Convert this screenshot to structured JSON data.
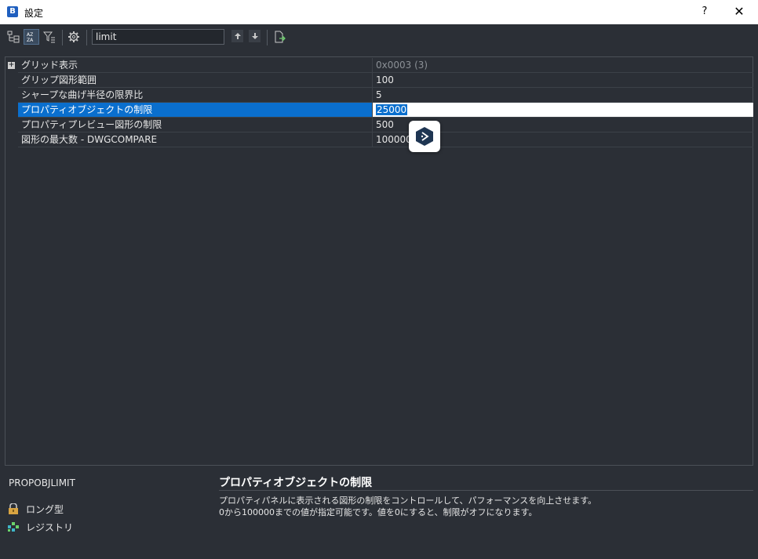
{
  "window": {
    "title": "設定",
    "help_label": "?",
    "close_label": "✕"
  },
  "toolbar": {
    "search_value": "limit",
    "buttons": [
      "categorized-view",
      "alphabetic-view",
      "filter",
      "settings",
      "previous",
      "next",
      "export"
    ]
  },
  "grid": {
    "rows": [
      {
        "name": "グリッド表示",
        "value": "0x0003 (3)",
        "expandable": true,
        "readonly": true
      },
      {
        "name": "グリップ図形範囲",
        "value": "100"
      },
      {
        "name": "シャープな曲げ半径の限界比",
        "value": "5"
      },
      {
        "name": "プロパティオブジェクトの制限",
        "value": "25000",
        "selected": true
      },
      {
        "name": "プロパティプレビュー図形の制限",
        "value": "500"
      },
      {
        "name": "図形の最大数 - DWGCOMPARE",
        "value": "100000"
      }
    ]
  },
  "info": {
    "variable": "PROPOBJLIMIT",
    "type_label": "ロング型",
    "storage_label": "レジストリ",
    "title": "プロパティオブジェクトの制限",
    "description_line1": "プロパティパネルに表示される図形の制限をコントロールして、パフォーマンスを向上させます。",
    "description_line2": "0から100000までの値が指定可能です。値を0にすると、制限がオフになります。"
  },
  "colors": {
    "selection": "#0a6fce",
    "background": "#2b2f36",
    "titlebar": "#ffffff"
  }
}
